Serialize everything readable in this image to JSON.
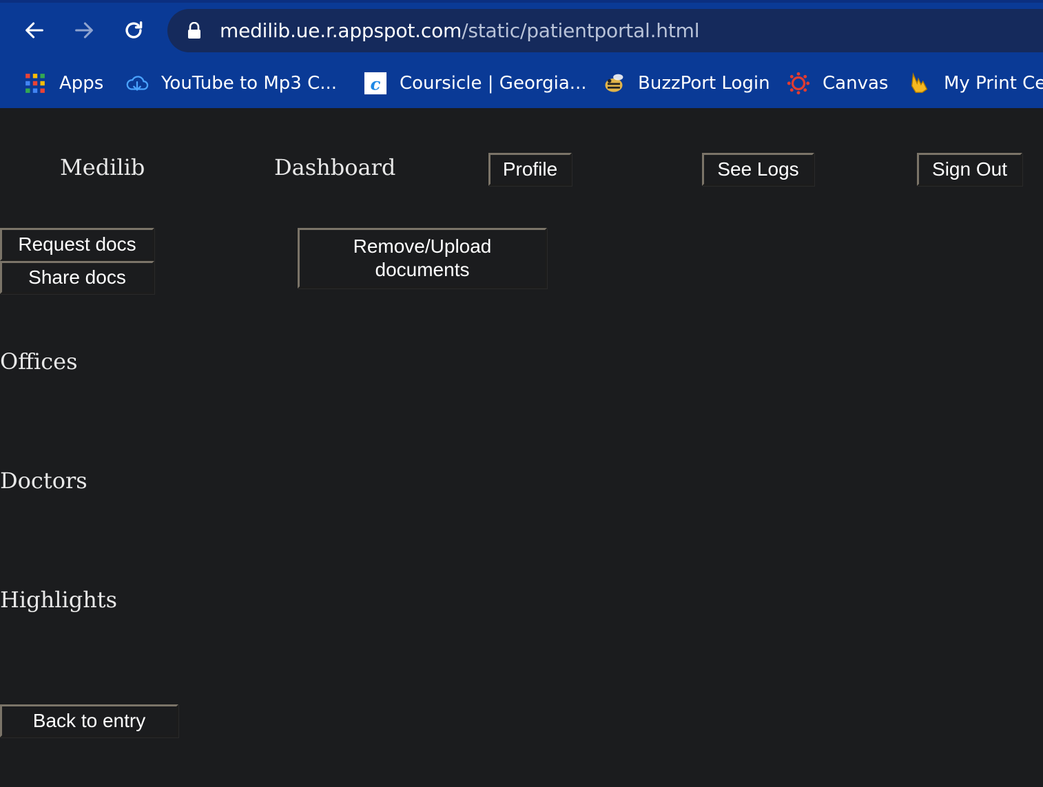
{
  "browser": {
    "url_host": "medilib.ue.r.appspot.com",
    "url_path": "/static/patientportal.html",
    "nav": {
      "back_icon": "arrow-left-icon",
      "forward_icon": "arrow-right-icon",
      "reload_icon": "reload-icon",
      "lock_icon": "lock-icon"
    },
    "bookmarks": [
      {
        "label": "Apps",
        "icon": "apps-grid-icon"
      },
      {
        "label": "YouTube to Mp3 C...",
        "icon": "cloud-download-icon"
      },
      {
        "label": "Coursicle | Georgia...",
        "icon": "coursicle-icon"
      },
      {
        "label": "BuzzPort Login",
        "icon": "buzz-icon"
      },
      {
        "label": "Canvas",
        "icon": "canvas-icon"
      },
      {
        "label": "My Print Cen",
        "icon": "print-hand-icon"
      }
    ]
  },
  "header": {
    "brand": "Medilib",
    "title": "Dashboard",
    "profile_label": "Profile",
    "logs_label": "See Logs",
    "signout_label": "Sign Out"
  },
  "actions": {
    "request_label": "Request docs",
    "share_label": "Share docs",
    "remove_upload_line1": "Remove/Upload",
    "remove_upload_line2": "documents"
  },
  "sections": {
    "offices": "Offices",
    "doctors": "Doctors",
    "highlights": "Highlights"
  },
  "footer": {
    "back_label": "Back to entry"
  },
  "colors": {
    "chrome_bg": "#0a3a96",
    "omnibox_bg": "#152a5c",
    "page_bg": "#1b1c1e",
    "button_border_light": "#7b7468"
  }
}
